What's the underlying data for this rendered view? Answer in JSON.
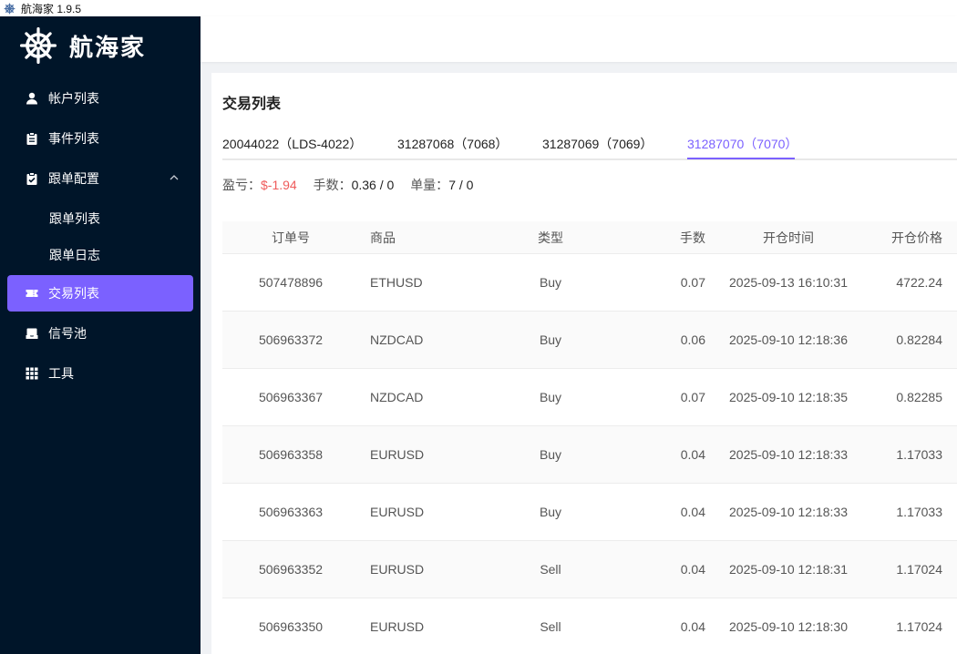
{
  "window": {
    "title": "航海家 1.9.5",
    "icon": "helm-icon"
  },
  "brand": {
    "name": "航海家",
    "logo": "ship-wheel-logo"
  },
  "sidebar": {
    "items": [
      {
        "label": "帐户列表",
        "icon": "user-icon"
      },
      {
        "label": "事件列表",
        "icon": "clipboard-icon"
      },
      {
        "label": "跟单配置",
        "icon": "clipboard-check-icon",
        "expanded": true,
        "children": [
          {
            "label": "跟单列表"
          },
          {
            "label": "跟单日志"
          }
        ]
      },
      {
        "label": "交易列表",
        "icon": "ticket-icon",
        "active": true
      },
      {
        "label": "信号池",
        "icon": "inbox-icon"
      },
      {
        "label": "工具",
        "icon": "grid-icon"
      }
    ]
  },
  "page": {
    "title": "交易列表"
  },
  "tabs": [
    {
      "label": "20044022（LDS-4022）"
    },
    {
      "label": "31287068（7068）"
    },
    {
      "label": "31287069（7069）"
    },
    {
      "label": "31287070（7070）",
      "active": true
    }
  ],
  "summary": {
    "pnl_label": "盈亏：",
    "pnl_value": "$-1.94",
    "lots_label": "手数：",
    "lots_value": "0.36 / 0",
    "count_label": "单量：",
    "count_value": "7 / 0"
  },
  "table": {
    "columns": [
      "订单号",
      "商品",
      "类型",
      "手数",
      "开仓时间",
      "开仓价格"
    ],
    "rows": [
      [
        "507478896",
        "ETHUSD",
        "Buy",
        "0.07",
        "2025-09-13 16:10:31",
        "4722.24"
      ],
      [
        "506963372",
        "NZDCAD",
        "Buy",
        "0.06",
        "2025-09-10 12:18:36",
        "0.82284"
      ],
      [
        "506963367",
        "NZDCAD",
        "Buy",
        "0.07",
        "2025-09-10 12:18:35",
        "0.82285"
      ],
      [
        "506963358",
        "EURUSD",
        "Buy",
        "0.04",
        "2025-09-10 12:18:33",
        "1.17033"
      ],
      [
        "506963363",
        "EURUSD",
        "Buy",
        "0.04",
        "2025-09-10 12:18:33",
        "1.17033"
      ],
      [
        "506963352",
        "EURUSD",
        "Sell",
        "0.04",
        "2025-09-10 12:18:31",
        "1.17024"
      ],
      [
        "506963350",
        "EURUSD",
        "Sell",
        "0.04",
        "2025-09-10 12:18:30",
        "1.17024"
      ]
    ]
  },
  "colors": {
    "sidebar_bg": "#001529",
    "accent": "#7b61ff",
    "negative": "#ef5b5b"
  }
}
